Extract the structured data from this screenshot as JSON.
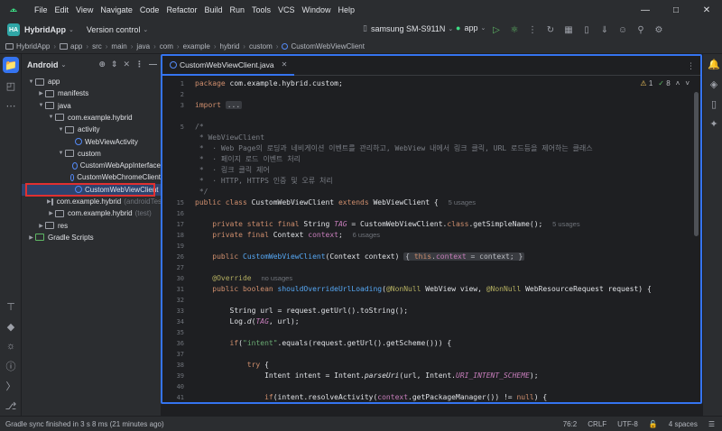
{
  "menu": [
    "File",
    "Edit",
    "View",
    "Navigate",
    "Code",
    "Refactor",
    "Build",
    "Run",
    "Tools",
    "VCS",
    "Window",
    "Help"
  ],
  "toolbar": {
    "project_badge": "HA",
    "project_name": "HybridApp",
    "version_control": "Version control",
    "device": "samsung SM-S911N",
    "run_config": "app"
  },
  "breadcrumb": [
    "HybridApp",
    "app",
    "src",
    "main",
    "java",
    "com",
    "example",
    "hybrid",
    "custom",
    "CustomWebViewClient"
  ],
  "project_panel": {
    "title": "Android",
    "tree": [
      {
        "label": "app",
        "type": "folder",
        "indent": 0,
        "expanded": true
      },
      {
        "label": "manifests",
        "type": "folder",
        "indent": 1
      },
      {
        "label": "java",
        "type": "folder",
        "indent": 1,
        "expanded": true
      },
      {
        "label": "com.example.hybrid",
        "type": "folder",
        "indent": 2,
        "expanded": true
      },
      {
        "label": "activity",
        "type": "folder",
        "indent": 3,
        "expanded": true
      },
      {
        "label": "WebViewActivity",
        "type": "class",
        "indent": 4
      },
      {
        "label": "custom",
        "type": "folder",
        "indent": 3,
        "expanded": true
      },
      {
        "label": "CustomWebAppInterface",
        "type": "class",
        "indent": 4
      },
      {
        "label": "CustomWebChromeClient",
        "type": "class",
        "indent": 4
      },
      {
        "label": "CustomWebViewClient",
        "type": "class",
        "indent": 4,
        "selected": true
      },
      {
        "label": "com.example.hybrid",
        "type": "folder",
        "indent": 2,
        "suffix": "(androidTest)"
      },
      {
        "label": "com.example.hybrid",
        "type": "folder",
        "indent": 2,
        "suffix": "(test)"
      },
      {
        "label": "res",
        "type": "folder",
        "indent": 1
      },
      {
        "label": "Gradle Scripts",
        "type": "gradle",
        "indent": 0
      }
    ]
  },
  "editor": {
    "tab_label": "CustomWebViewClient.java",
    "warnings": "1",
    "weak_warnings": "8",
    "line_numbers": [
      "1",
      "2",
      "3",
      "",
      "",
      "",
      "",
      "",
      "",
      "",
      "",
      "",
      "15",
      "16",
      "17",
      "",
      "26",
      "27",
      "28",
      "29",
      "32",
      "33",
      "34",
      "35",
      "36",
      "37",
      "38",
      "39",
      "40",
      "41",
      "42",
      "43"
    ],
    "usages_5": "5 usages",
    "usages_5b": "5 usages",
    "usages_6": "6 usages",
    "no_usages": "no usages"
  },
  "status": {
    "message": "Gradle sync finished in 3 s 8 ms (21 minutes ago)",
    "position": "76:2",
    "line_sep": "CRLF",
    "encoding": "UTF-8",
    "indent": "4 spaces"
  }
}
